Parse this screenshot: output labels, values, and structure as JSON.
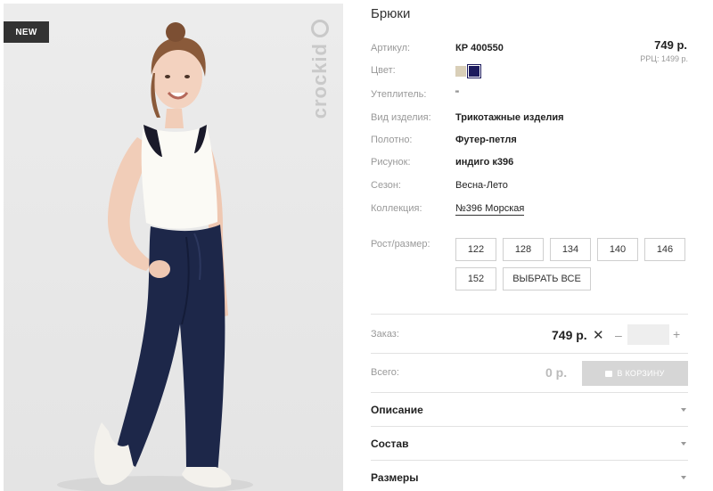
{
  "photo": {
    "badge": "NEW",
    "watermark": "crockid"
  },
  "product": {
    "title": "Брюки",
    "price": "749 р.",
    "rrp": "РРЦ: 1499 р.",
    "attributes": [
      {
        "label": "Артикул:",
        "value": "КР 400550"
      },
      {
        "label": "Цвет:",
        "value": ""
      },
      {
        "label": "Утеплитель:",
        "value": "\""
      },
      {
        "label": "Вид изделия:",
        "value": "Трикотажные изделия"
      },
      {
        "label": "Полотно:",
        "value": "Футер-петля"
      },
      {
        "label": "Рисунок:",
        "value": "индиго к396"
      },
      {
        "label": "Сезон:",
        "value": "Весна-Лето"
      },
      {
        "label": "Коллекция:",
        "value": "№396 Морская"
      }
    ],
    "colors": [
      "#d9cfb8",
      "#1c1b5e"
    ]
  },
  "sizes": {
    "label": "Рост/размер:",
    "options": [
      "122",
      "128",
      "134",
      "140",
      "146",
      "152"
    ],
    "select_all": "ВЫБРАТЬ ВСЕ"
  },
  "order": {
    "label": "Заказ:",
    "price": "749 р.",
    "times": "✕",
    "minus": "–",
    "plus": "+",
    "quantity": ""
  },
  "total": {
    "label": "Всего:",
    "value": "0 р.",
    "cart_button": "В КОРЗИНУ"
  },
  "sections": [
    "Описание",
    "Состав",
    "Размеры"
  ]
}
